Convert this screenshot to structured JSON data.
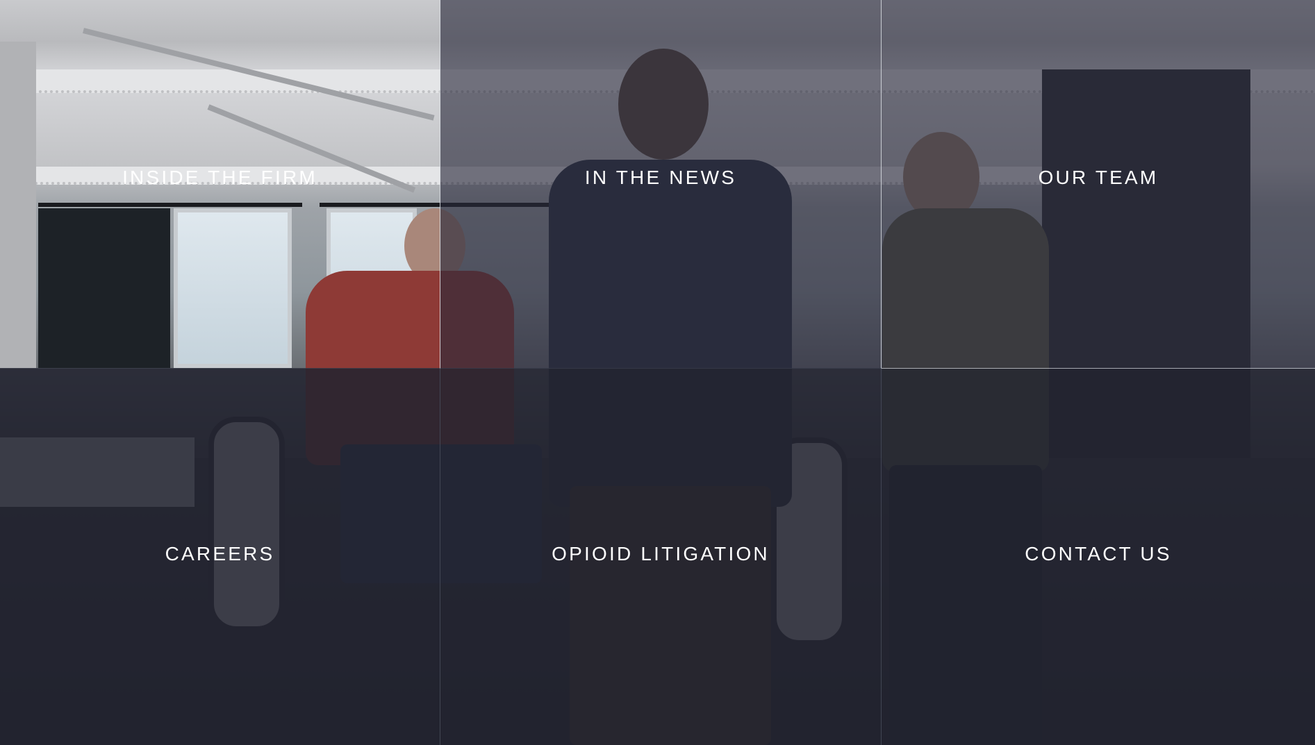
{
  "navigation_tiles": [
    {
      "id": "inside-the-firm",
      "label": "INSIDE THE FIRM"
    },
    {
      "id": "in-the-news",
      "label": "IN THE NEWS"
    },
    {
      "id": "our-team",
      "label": "OUR TEAM"
    },
    {
      "id": "careers",
      "label": "CAREERS"
    },
    {
      "id": "opioid-litigation",
      "label": "OPIOID LITIGATION"
    },
    {
      "id": "contact-us",
      "label": "CONTACT US"
    }
  ],
  "colors": {
    "overlay": "#222330",
    "label_text": "#ffffff",
    "divider": "#dce0e6"
  }
}
